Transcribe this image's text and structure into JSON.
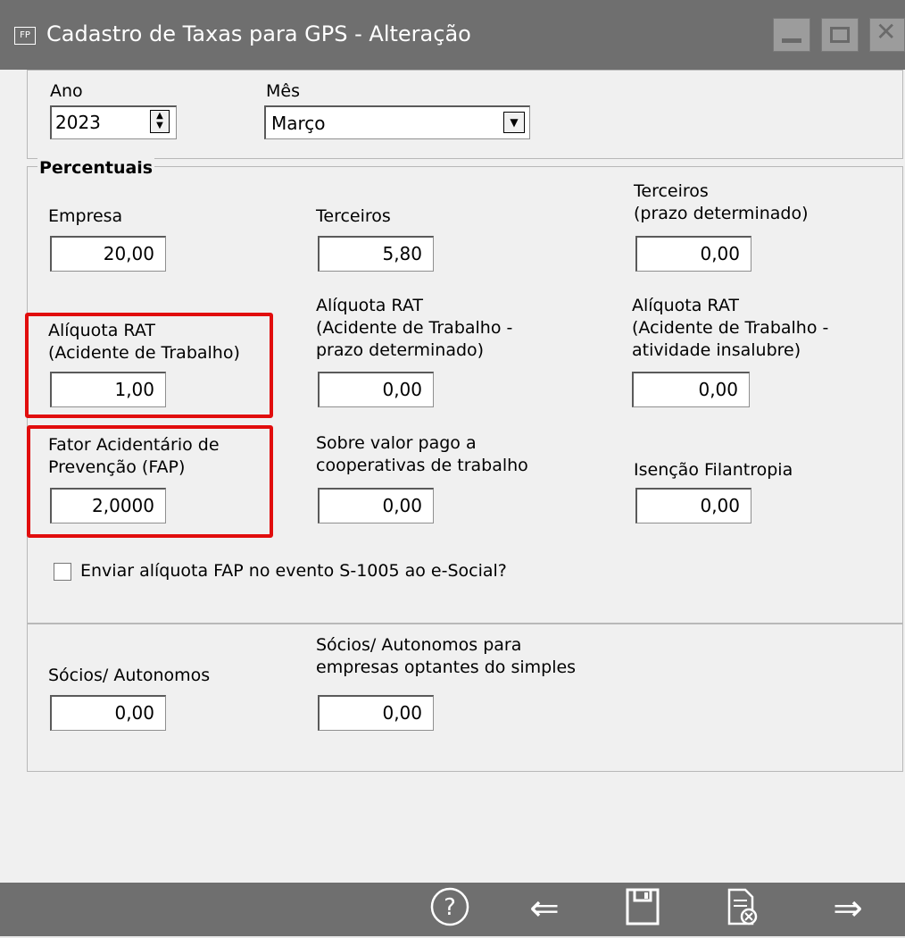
{
  "window": {
    "title": "Cadastro de Taxas para GPS - Alteração",
    "app_icon_text": "FP"
  },
  "period": {
    "ano_label": "Ano",
    "ano_value": "2023",
    "mes_label": "Mês",
    "mes_value": "Março"
  },
  "percentuais": {
    "group_title": "Percentuais",
    "empresa_label": "Empresa",
    "empresa_value": "20,00",
    "terceiros_label": "Terceiros",
    "terceiros_value": "5,80",
    "terceiros_prazo_label": "Terceiros\n(prazo determinado)",
    "terceiros_prazo_value": "0,00",
    "rat_label": "Alíquota RAT\n(Acidente de Trabalho)",
    "rat_value": "1,00",
    "rat_prazo_label": "Alíquota RAT\n(Acidente de Trabalho -\nprazo determinado)",
    "rat_prazo_value": "0,00",
    "rat_insalubre_label": "Alíquota RAT\n(Acidente de Trabalho -\natividade insalubre)",
    "rat_insalubre_value": "0,00",
    "fap_label": "Fator Acidentário de\nPrevenção (FAP)",
    "fap_value": "2,0000",
    "cooperativas_label": "Sobre valor pago a\ncooperativas de trabalho",
    "cooperativas_value": "0,00",
    "isencao_label": "Isenção Filantropia",
    "isencao_value": "0,00",
    "enviar_fap_label": "Enviar alíquota FAP no evento S-1005 ao e-Social?",
    "enviar_fap_checked": false
  },
  "socios": {
    "socios_label": "Sócios/ Autonomos",
    "socios_value": "0,00",
    "socios_simples_label": "Sócios/ Autonomos para\nempresas optantes do simples",
    "socios_simples_value": "0,00"
  },
  "toolbar": {
    "help_icon": "?",
    "prev_icon": "⇐",
    "save_icon": "save",
    "cancel_icon": "cancel",
    "next_icon": "⇒"
  },
  "colors": {
    "highlight": "#e10d0d",
    "titlebar": "#6f6f6f"
  }
}
